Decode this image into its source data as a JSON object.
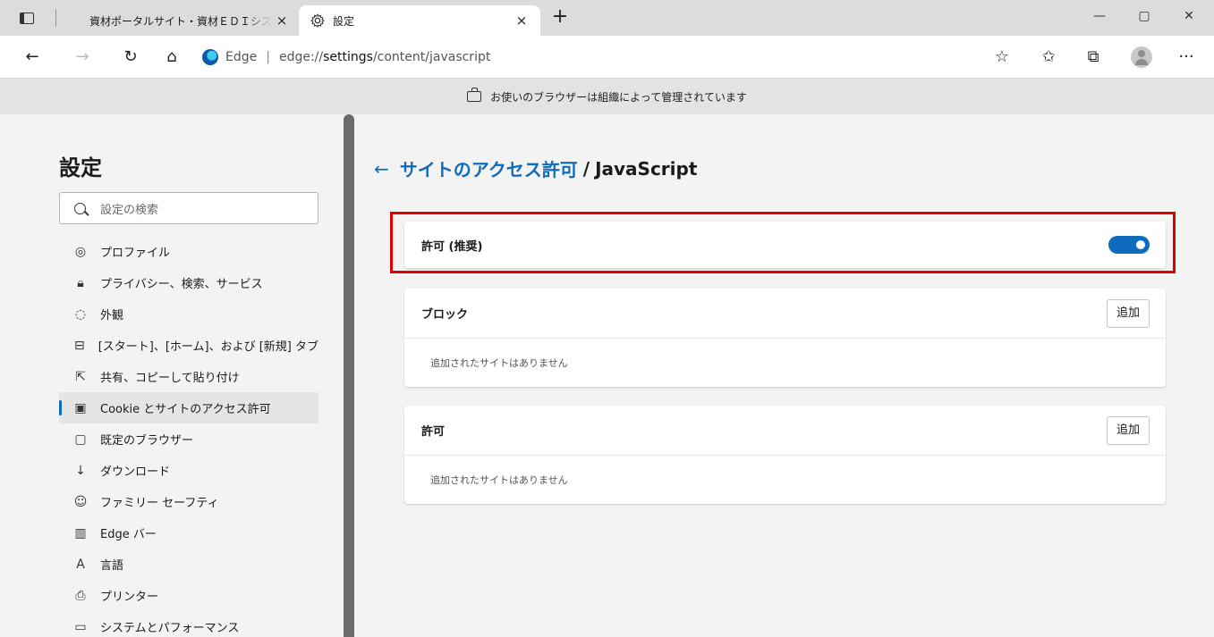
{
  "tabs": {
    "inactive_title": "資材ポータルサイト・資材ＥＤＩシステム",
    "active_title": "設定",
    "close": "×",
    "new_tab": "+"
  },
  "window_controls": {
    "minimize": "—",
    "maximize": "▢",
    "close": "✕"
  },
  "nav": {
    "back": "←",
    "forward": "→",
    "refresh": "↻",
    "home": "⌂",
    "browser_name": "Edge",
    "url_prefix": "edge://",
    "url_bold": "settings",
    "url_rest": "/content/javascript",
    "favorites_add": "☆",
    "favorites": "✩",
    "collections": "⧉",
    "more": "···"
  },
  "managed_banner": "お使いのブラウザーは組織によって管理されています",
  "sidebar": {
    "title": "設定",
    "search_placeholder": "設定の検索",
    "items": [
      {
        "label": "プロファイル",
        "icon": "profile-icon",
        "glyph": "◎"
      },
      {
        "label": "プライバシー、検索、サービス",
        "icon": "lock-icon",
        "glyph": "🔒︎"
      },
      {
        "label": "外観",
        "icon": "palette-icon",
        "glyph": "◌"
      },
      {
        "label": "[スタート]、[ホーム]、および [新規] タブ",
        "icon": "home-grid-icon",
        "glyph": "⊟"
      },
      {
        "label": "共有、コピーして貼り付け",
        "icon": "share-icon",
        "glyph": "⇱"
      },
      {
        "label": "Cookie とサイトのアクセス許可",
        "icon": "cookie-settings-icon",
        "glyph": "▣"
      },
      {
        "label": "既定のブラウザー",
        "icon": "default-browser-icon",
        "glyph": "▢"
      },
      {
        "label": "ダウンロード",
        "icon": "download-icon",
        "glyph": "↓"
      },
      {
        "label": "ファミリー セーフティ",
        "icon": "family-icon",
        "glyph": "☺"
      },
      {
        "label": "Edge バー",
        "icon": "edge-bar-icon",
        "glyph": "▥"
      },
      {
        "label": "言語",
        "icon": "language-icon",
        "glyph": "A"
      },
      {
        "label": "プリンター",
        "icon": "printer-icon",
        "glyph": "⎙"
      },
      {
        "label": "システムとパフォーマンス",
        "icon": "system-icon",
        "glyph": "▭"
      }
    ]
  },
  "content": {
    "back_arrow": "←",
    "breadcrumb_link": "サイトのアクセス許可",
    "breadcrumb_sep": "/",
    "breadcrumb_current": "JavaScript",
    "allow_label": "許可 (推奨)",
    "allow_enabled": true,
    "block_title": "ブロック",
    "block_add": "追加",
    "block_empty": "追加されたサイトはありません",
    "permit_title": "許可",
    "permit_add": "追加",
    "permit_empty": "追加されたサイトはありません"
  },
  "colors": {
    "accent": "#0f6cbd",
    "highlight": "#e00000"
  }
}
